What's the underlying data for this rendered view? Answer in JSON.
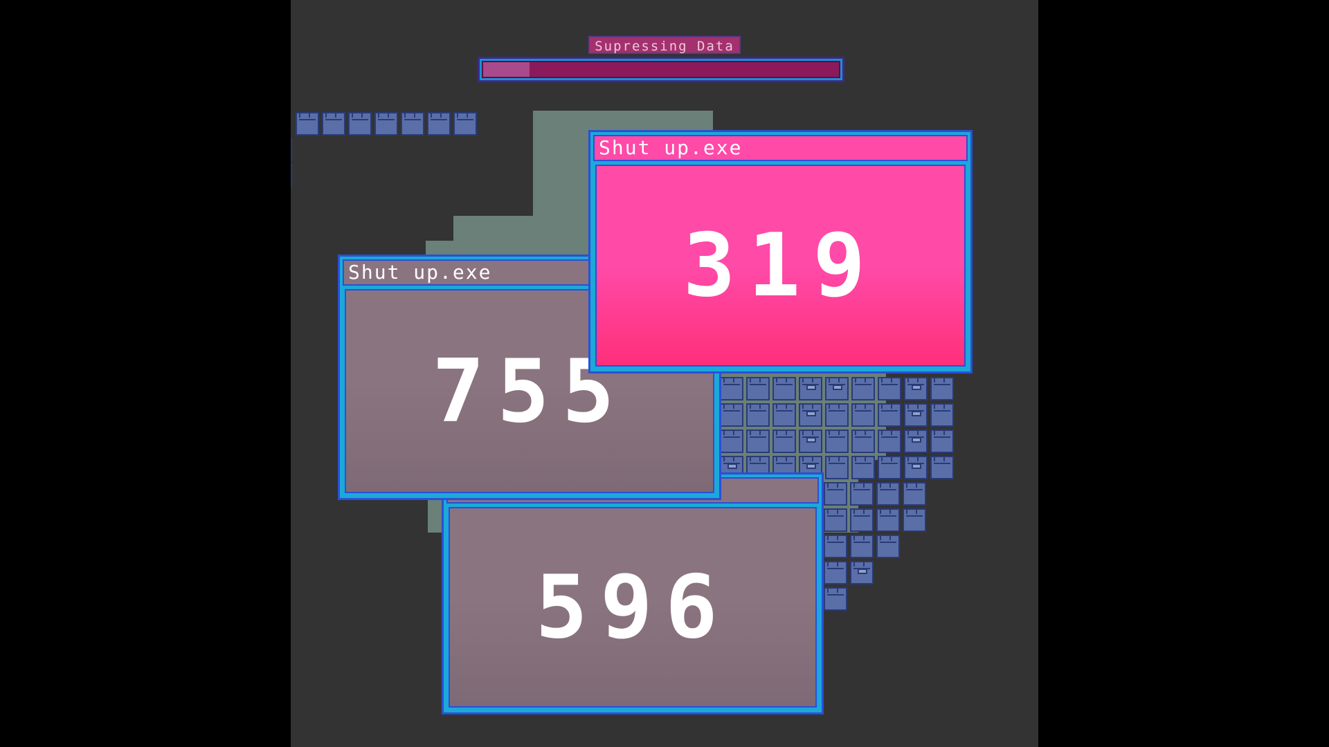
{
  "progress": {
    "label": "Supressing Data",
    "value": 0.13,
    "colors": {
      "frame": "#1a8fd6",
      "track": "#8a1a5c",
      "fill": "#a84a8c",
      "label_bg": "#a3316d"
    }
  },
  "windows": [
    {
      "id": "window-596",
      "title": "",
      "number": "596",
      "theme": "grey"
    },
    {
      "id": "window-755",
      "title": "Shut up.exe",
      "number": "755",
      "theme": "grey"
    },
    {
      "id": "window-319",
      "title": "Shut up.exe",
      "number": "319",
      "theme": "pink"
    }
  ],
  "icons": {
    "folder": "folder-icon",
    "locked_folder": "locked-folder-icon"
  },
  "colors": {
    "stage": "#333333",
    "letterbox": "#000000",
    "folder": "#5a6fa8",
    "cluster": "#6a8078",
    "window_border": "#1ca8d8"
  }
}
